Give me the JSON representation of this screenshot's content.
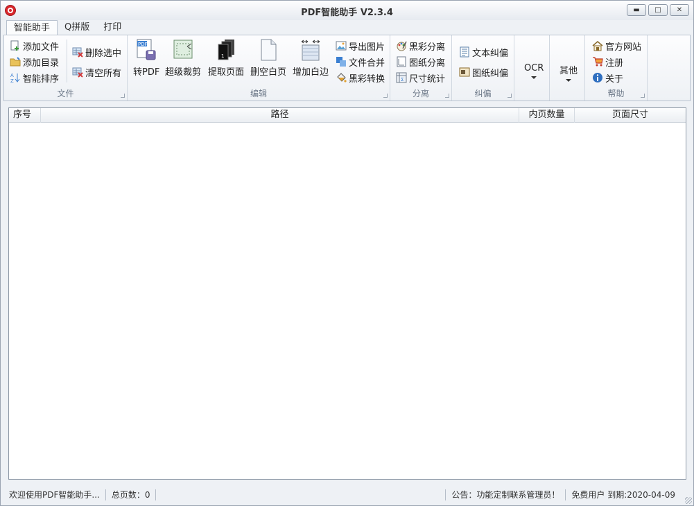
{
  "window": {
    "title": "PDF智能助手 V2.3.4",
    "min_glyph": "▬",
    "max_glyph": "□",
    "close_glyph": "✕"
  },
  "tabs": [
    "智能助手",
    "Q拼版",
    "打印"
  ],
  "ribbon": {
    "file": {
      "label": "文件",
      "add_file": "添加文件",
      "add_dir": "添加目录",
      "smart_sort": "智能排序",
      "delete_selected": "删除选中",
      "clear_all": "清空所有"
    },
    "edit": {
      "label": "编辑",
      "to_pdf": "转PDF",
      "super_crop": "超级裁剪",
      "extract_pages": "提取页面",
      "delete_blank": "删空白页",
      "add_margin": "增加白边",
      "export_images": "导出图片",
      "merge_files": "文件合并",
      "bw_convert": "黑彩转换"
    },
    "separate": {
      "label": "分离",
      "bw_separate": "黑彩分离",
      "drawing_separate": "图纸分离",
      "size_stats": "尺寸统计"
    },
    "deskew": {
      "label": "纠偏",
      "text_deskew": "文本纠偏",
      "drawing_deskew": "图纸纠偏"
    },
    "ocr": {
      "label": "OCR"
    },
    "other": {
      "label": "其他"
    },
    "help": {
      "label": "帮助",
      "website": "官方网站",
      "register": "注册",
      "about": "关于"
    }
  },
  "list": {
    "columns": [
      "序号",
      "路径",
      "内页数量",
      "页面尺寸"
    ],
    "rows": []
  },
  "status": {
    "welcome": "欢迎使用PDF智能助手...",
    "total_pages": "总页数：0",
    "notice": "公告：功能定制联系管理员！",
    "user": "免费用户 到期:2020-04-09"
  }
}
